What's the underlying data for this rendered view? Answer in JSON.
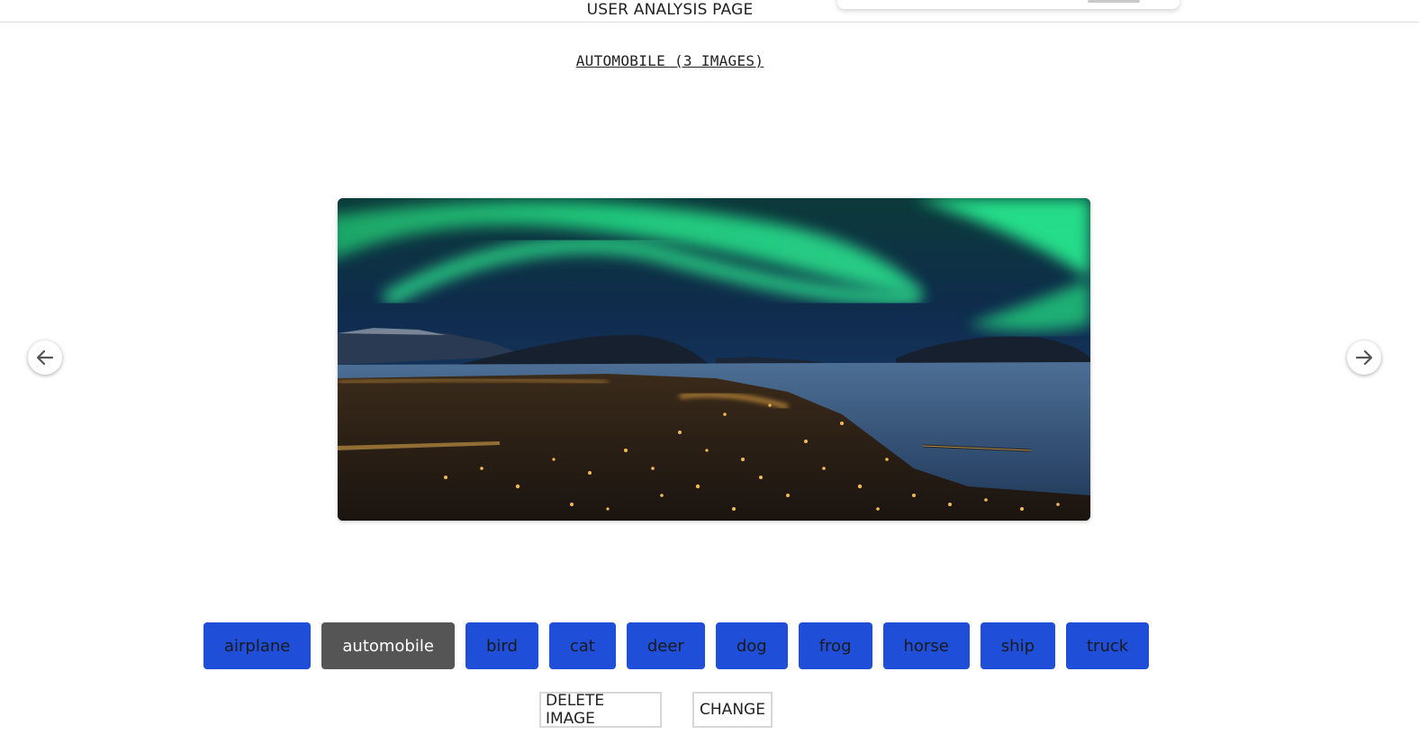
{
  "header": {
    "title": "USER ANALYSIS PAGE"
  },
  "gallery": {
    "heading": "AUTOMOBILE (3 IMAGES)",
    "image_alt": "Night city by the water under green aurora",
    "prev_icon": "arrow-left-icon",
    "next_icon": "arrow-right-icon"
  },
  "labels": {
    "items": [
      {
        "label": "airplane",
        "active": false
      },
      {
        "label": "automobile",
        "active": true
      },
      {
        "label": "bird",
        "active": false
      },
      {
        "label": "cat",
        "active": false
      },
      {
        "label": "deer",
        "active": false
      },
      {
        "label": "dog",
        "active": false
      },
      {
        "label": "frog",
        "active": false
      },
      {
        "label": "horse",
        "active": false
      },
      {
        "label": "ship",
        "active": false
      },
      {
        "label": "truck",
        "active": false
      }
    ],
    "colors": {
      "default_bg": "#1f4fd8",
      "active_bg": "#555555"
    }
  },
  "actions": {
    "delete_label": "DELETE IMAGE",
    "change_label": "CHANGE"
  }
}
